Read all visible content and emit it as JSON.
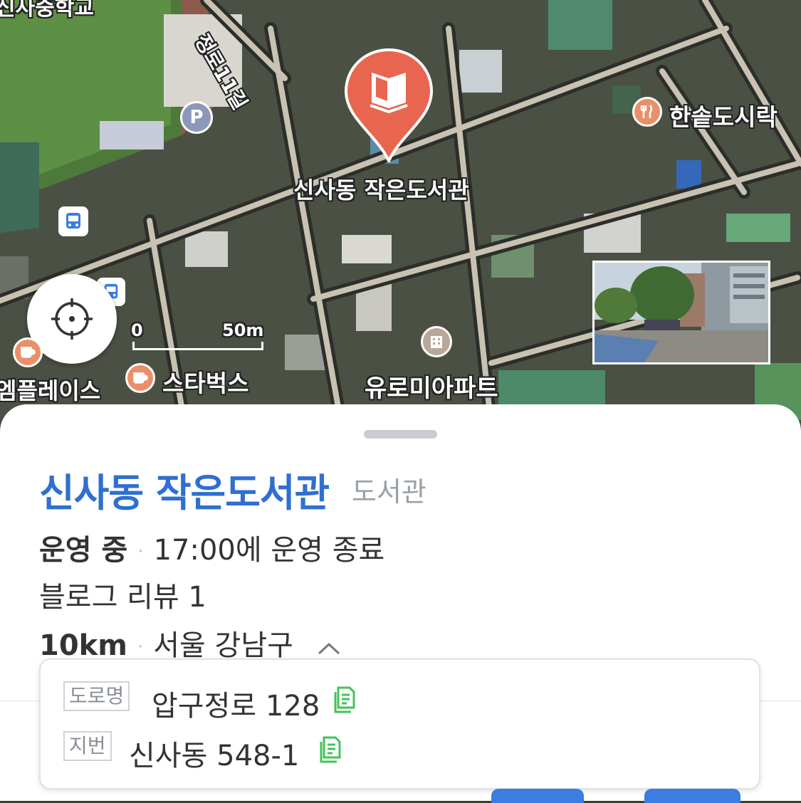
{
  "map": {
    "road_label": "정로11길",
    "school_label": "신사중학교",
    "selected_place_label": "신사동 작은도서관",
    "poi_labels": {
      "restaurant": "한솥도시락",
      "starbucks": "스타벅스",
      "place_left": "엠플레이스",
      "apartment": "유로미아파트"
    },
    "parking_symbol": "P",
    "scale": {
      "zero": "0",
      "distance": "50m"
    },
    "colors": {
      "marker": "#e8664f",
      "cafe_poi": "#e8906a",
      "restaurant_poi": "#e8906a",
      "parking": "#8c98b8",
      "bus": "#3b7de0"
    },
    "icons": [
      "book-icon",
      "locate-me-icon",
      "parking-icon",
      "bus-stop-icon",
      "cafe-icon",
      "fork-knife-icon",
      "building-icon"
    ]
  },
  "place": {
    "name": "신사동 작은도서관",
    "category": "도서관",
    "status": "운영 중",
    "hours": "17:00에 운영 종료",
    "reviews": "블로그 리뷰 1",
    "distance": "10km",
    "district": "서울 강남구"
  },
  "address": {
    "road_tag": "도로명",
    "road": "압구정로 128",
    "lot_tag": "지번",
    "lot": "신사동 548-1"
  }
}
